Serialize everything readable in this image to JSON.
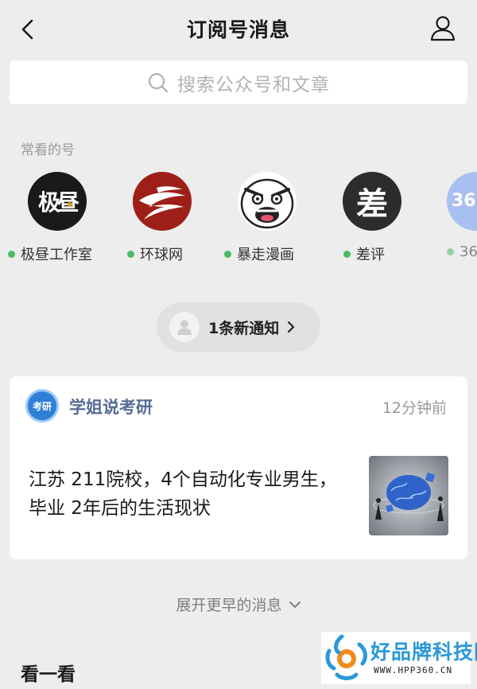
{
  "header": {
    "title": "订阅号消息"
  },
  "search": {
    "placeholder": "搜索公众号和文章"
  },
  "frequent": {
    "label": "常看的号",
    "accounts": [
      {
        "name": "极昼工作室",
        "logo_text": "极昼",
        "bg": "#1a1a1a",
        "online": true
      },
      {
        "name": "环球网",
        "logo_text": "",
        "bg": "#9e1f19",
        "online": true
      },
      {
        "name": "暴走漫画",
        "logo_text": "",
        "bg": "#ffffff",
        "online": true
      },
      {
        "name": "差评",
        "logo_text": "差",
        "bg": "#2c2c2c",
        "online": true
      },
      {
        "name": "36",
        "logo_text": "36",
        "bg": "#a8bff2",
        "online": true
      }
    ]
  },
  "notification": {
    "text": "1条新通知"
  },
  "article": {
    "account_name": "学姐说考研",
    "account_logo_text": "考研",
    "time": "12分钟前",
    "headline": "江苏 211院校，4个自动化专业男生，毕业 2年后的生活现状"
  },
  "expand": {
    "label": "展开更早的消息"
  },
  "look": {
    "title": "看一看"
  },
  "watermark": {
    "text": "好品牌科技网",
    "url": "WWW.HPP360.CN"
  },
  "colors": {
    "accent_green": "#4cbc64",
    "link_blue": "#576b95",
    "background": "#ededed"
  }
}
